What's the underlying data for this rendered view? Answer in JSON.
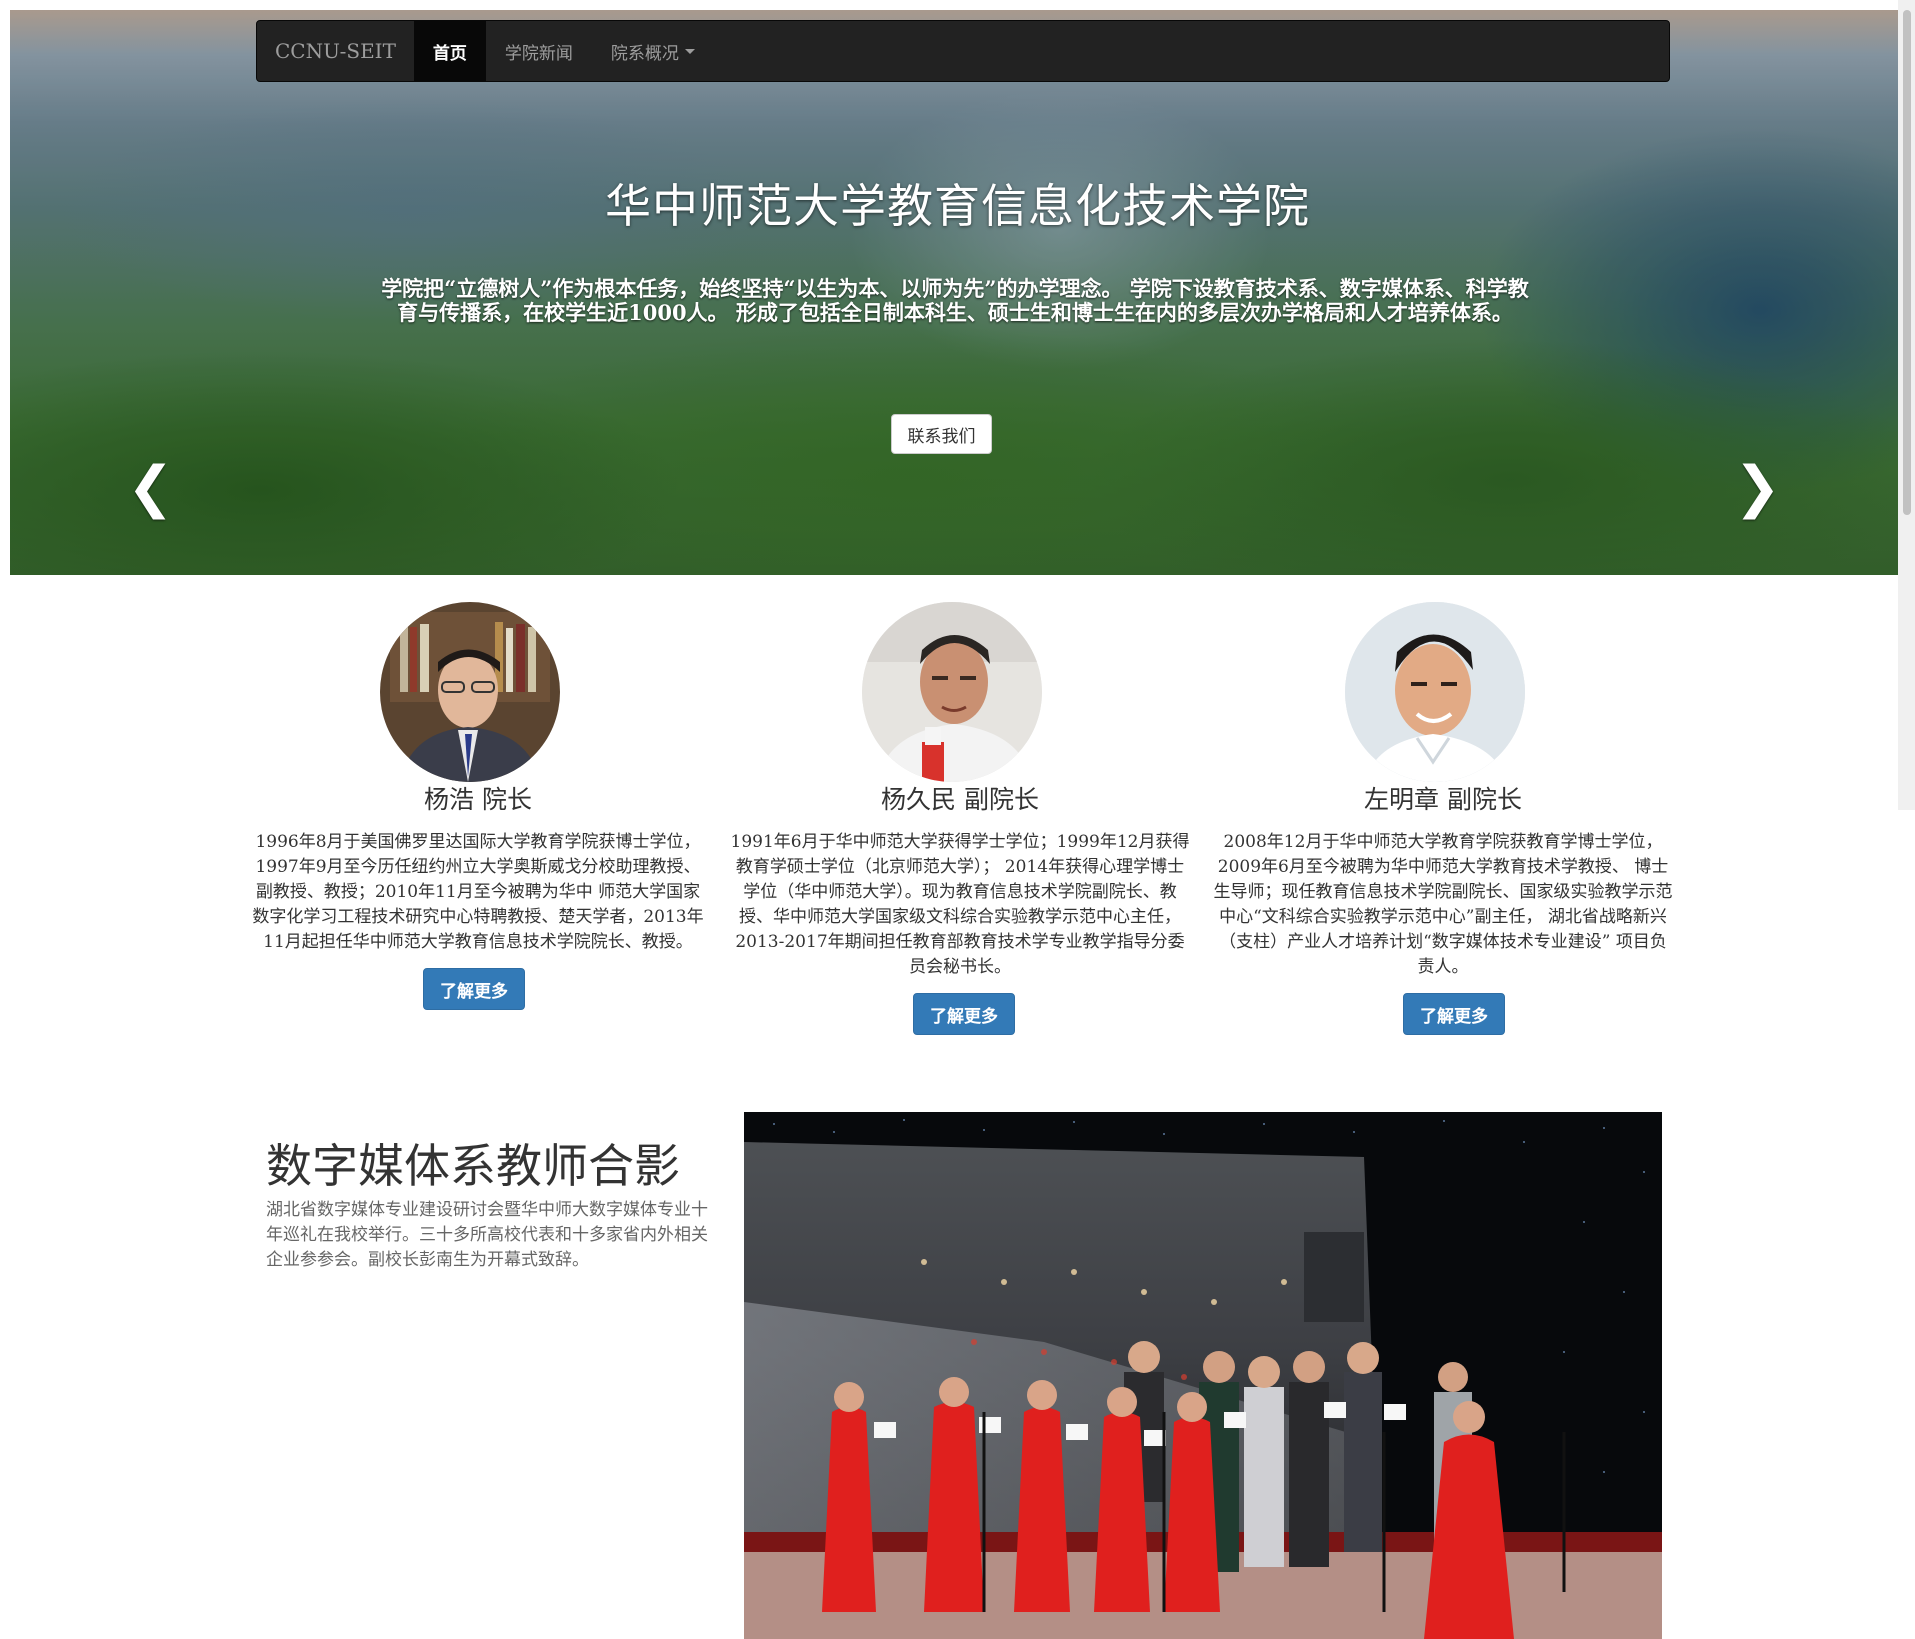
{
  "navbar": {
    "brand": "CCNU-SEIT",
    "items": [
      {
        "label": "首页",
        "active": true
      },
      {
        "label": "学院新闻",
        "active": false
      },
      {
        "label": "院系概况",
        "active": false,
        "dropdown": true
      }
    ]
  },
  "hero": {
    "title": "华中师范大学教育信息化技术学院",
    "description": "学院把“立德树人”作为根本任务，始终坚持“以生为本、以师为先”的办学理念。 学院下设教育技术系、数字媒体系、科学教育与传播系，在校学生近1000人。 形成了包括全日制本科生、硕士生和博士生在内的多层次办学格局和人才培养体系。",
    "button": "联系我们",
    "prev_icon": "chevron-left-icon",
    "next_icon": "chevron-right-icon",
    "prev_glyph": "❮",
    "next_glyph": "❯"
  },
  "people": [
    {
      "name": "杨浩 院长",
      "bio": "1996年8月于美国佛罗里达国际大学教育学院获博士学位，1997年9月至今历任纽约州立大学奥斯威戈分校助理教授、副教授、教授；2010年11月至今被聘为华中 师范大学国家数字化学习工程技术研究中心特聘教授、楚天学者，2013年11月起担任华中师范大学教育信息技术学院院长、教授。",
      "button": "了解更多"
    },
    {
      "name": "杨久民 副院长",
      "bio": "1991年6月于华中师范大学获得学士学位；1999年12月获得教育学硕士学位（北京师范大学）； 2014年获得心理学博士学位（华中师范大学）。现为教育信息技术学院副院长、教授、华中师范大学国家级文科综合实验教学示范中心主任， 2013-2017年期间担任教育部教育技术学专业教学指导分委员会秘书长。",
      "button": "了解更多"
    },
    {
      "name": "左明章 副院长",
      "bio": "2008年12月于华中师范大学教育学院获教育学博士学位，2009年6月至今被聘为华中师范大学教育技术学教授、 博士生导师；现任教育信息技术学院副院长、国家级实验教学示范中心“文科综合实验教学示范中心”副主任， 湖北省战略新兴（支柱）产业人才培养计划“数字媒体技术专业建设” 项目负责人。",
      "button": "了解更多"
    }
  ],
  "feature": {
    "heading": "数字媒体系教师合影",
    "text": "湖北省数字媒体专业建设研讨会暨华中师大数字媒体专业十年巡礼在我校举行。三十多所高校代表和十多家省内外相关企业参参会。副校长彭南生为开幕式致辞。"
  },
  "colors": {
    "navbar_bg": "#222222",
    "primary": "#337ab7",
    "dress_red": "#e0201e"
  }
}
